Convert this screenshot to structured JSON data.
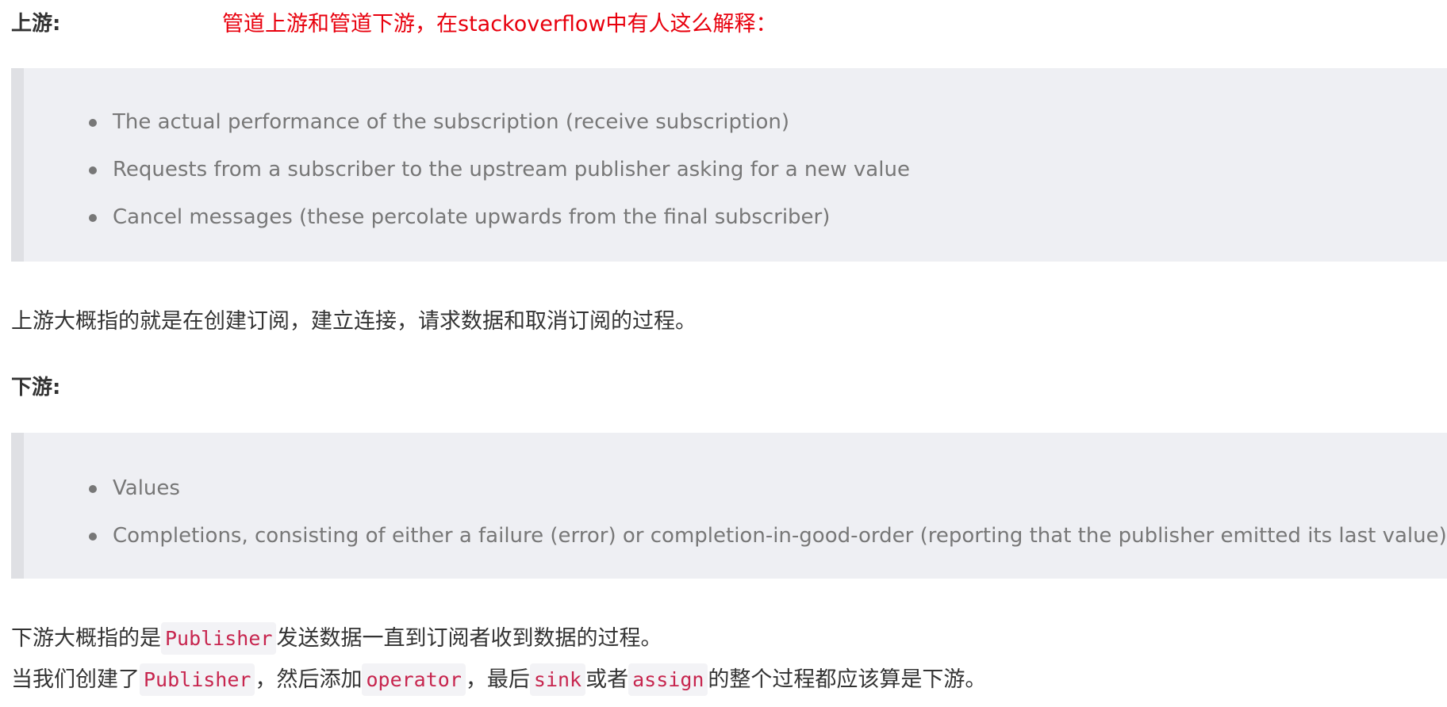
{
  "upstream": {
    "heading": "上游:",
    "note": "管道上游和管道下游，在stackoverflow中有人这么解释：",
    "quote_items": [
      "The actual performance of the subscription (receive subscription)",
      "Requests from a subscriber to the upstream publisher asking for a new value",
      "Cancel messages (these percolate upwards from the final subscriber)"
    ],
    "summary": "上游大概指的就是在创建订阅，建立连接，请求数据和取消订阅的过程。"
  },
  "downstream": {
    "heading": "下游:",
    "quote_items": [
      "Values",
      "Completions, consisting of either a failure (error) or completion-in-good-order (reporting that the publisher emitted its last value)"
    ],
    "summary_line1": {
      "before": "下游大概指的是",
      "code1": "Publisher",
      "after": "发送数据一直到订阅者收到数据的过程。"
    },
    "summary_line2": {
      "t1": "当我们创建了",
      "code1": "Publisher",
      "t2": "，然后添加",
      "code2": "operator",
      "t3": "，最后",
      "code3": "sink",
      "t4": "或者",
      "code4": "assign",
      "t5": "的整个过程都应该算是下游。"
    }
  }
}
